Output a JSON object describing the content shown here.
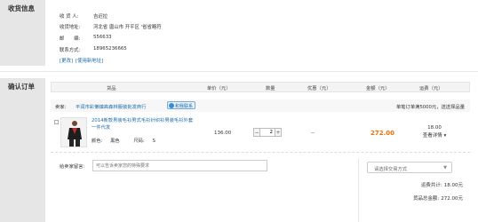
{
  "sections": {
    "shipping": "收货信息",
    "order": "确认订单"
  },
  "address": {
    "receiver_label": "收 货 人:",
    "receiver": "吉迟拉",
    "address_label": "收货地址:",
    "address": "河北省 唐山市 开平区 '省省略符",
    "postcode_label": "邮　　编:",
    "postcode": "556633",
    "phone_label": "联系方式:",
    "phone": "18965236665",
    "change_link": "[更改]",
    "new_address_link": "[使用新地址]"
  },
  "table": {
    "col_goods": "货品",
    "col_unit_price": "单价（元）",
    "col_quantity": "数量",
    "col_discount": "优惠（元）",
    "col_amount": "金额（元）",
    "col_shipping": "运费（元）"
  },
  "store": {
    "label": "卖家:",
    "name": "平润市彩懒镇高森林服装批发商行",
    "chat_label": "和我联系",
    "note": "单笔订单满5000元，送送择品量"
  },
  "item": {
    "title": "2014新款男装毛衫男式毛衫针织衫男装毛衫外套一件代发",
    "color_label": "颜色:",
    "color": "黑色",
    "size_label": "尺码:",
    "size": "S",
    "unit_price": "136.00",
    "quantity": "2",
    "qty_minus": "−",
    "qty_plus": "+",
    "discount": "--",
    "amount": "272.00",
    "shipping": "18.00",
    "shipping_detail": "查看详情"
  },
  "message": {
    "label": "给卖家留言:",
    "placeholder": "可以告诉卖家您的特殊要求"
  },
  "delivery_select": "请选择交易方式",
  "summary": {
    "shipping_total_label": "运费共计:",
    "shipping_total": "18.00元",
    "goods_total_label": "货品总金额:",
    "goods_total": "272.00元"
  },
  "colors": {
    "accent": "#f56d00",
    "link": "#1a6aa8"
  }
}
